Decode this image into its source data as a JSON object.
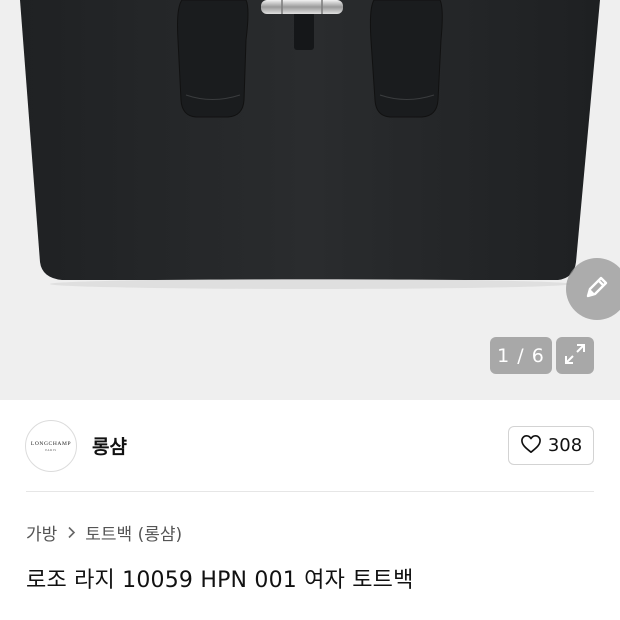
{
  "gallery": {
    "counter_text": "1 / 6",
    "icons": {
      "edit": "pencil-icon",
      "expand": "expand-icon"
    }
  },
  "brand": {
    "name": "롱샴",
    "logo_text": "LONGCHAMP",
    "logo_subtext": "PARIS",
    "like_count": "308",
    "like_icon": "heart-outline-icon"
  },
  "breadcrumb": {
    "items": [
      "가방",
      "토트백 (롱샴)"
    ],
    "separator_icon": "chevron-right-icon"
  },
  "product": {
    "title": "로조 라지 10059 HPN 001 여자 토트백"
  },
  "colors": {
    "image_background": "#efefef",
    "bag_body": "#27292b",
    "overlay_button": "#969696",
    "text_primary": "#111111",
    "text_secondary": "#555555"
  }
}
